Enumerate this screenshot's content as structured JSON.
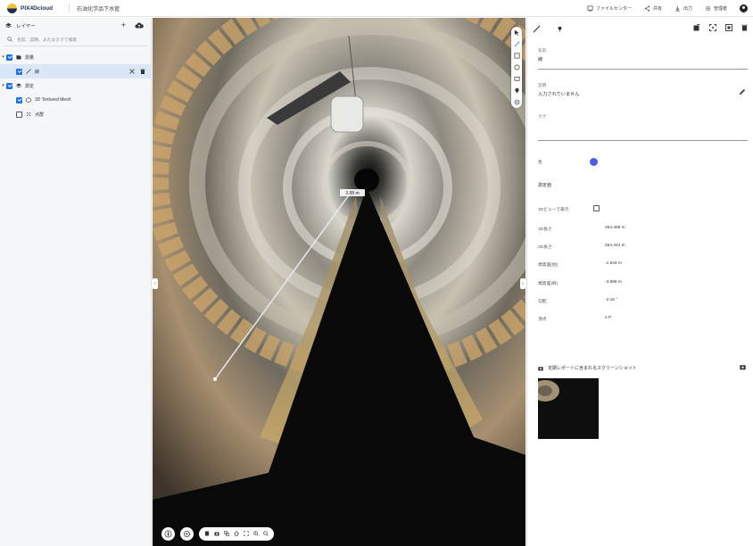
{
  "app": {
    "logo_text": "PIX4Dcloud",
    "project_name": "石油化学品下水管"
  },
  "top_actions": [
    {
      "icon": "share-network-icon",
      "label": "ファイルセンター"
    },
    {
      "icon": "share-icon",
      "label": "共有"
    },
    {
      "icon": "download-icon",
      "label": "出力"
    },
    {
      "icon": "settings-icon",
      "label": "管理者"
    }
  ],
  "layers": {
    "title": "レイヤー",
    "search_placeholder": "名前、説明、またはタグで検索",
    "items": [
      {
        "label": "測量",
        "checked": true,
        "level": 0
      },
      {
        "label": "線",
        "checked": true,
        "level": 1,
        "selected": true
      },
      {
        "label": "測定",
        "checked": true,
        "level": 0
      },
      {
        "label": "3D Textured Mesh",
        "checked": true,
        "level": 1
      },
      {
        "label": "点群",
        "checked": false,
        "level": 1
      }
    ]
  },
  "viewer": {
    "measurement_label": "3.88 m"
  },
  "props": {
    "name_label": "名前",
    "name_value": "線",
    "desc_label": "説明",
    "desc_value": "入力されていません",
    "tags_label": "タグ",
    "color_label": "色",
    "color_value": "#4a5fe0",
    "measure_title": "測定値",
    "show_in_view_label": "3Dビューで表示",
    "metrics": [
      {
        "label": "3D長さ",
        "value": "264.469 m"
      },
      {
        "label": "2D長さ",
        "value": "264.444 m"
      },
      {
        "label": "標高差(始)",
        "value": "-1.944 m"
      },
      {
        "label": "標高差(終)",
        "value": "-3.588 m"
      },
      {
        "label": "勾配",
        "value": "-2.16 °"
      },
      {
        "label": "頂点",
        "value": "2 P"
      }
    ],
    "report_label": "定期レポートに含まれるスクリーンショット"
  }
}
